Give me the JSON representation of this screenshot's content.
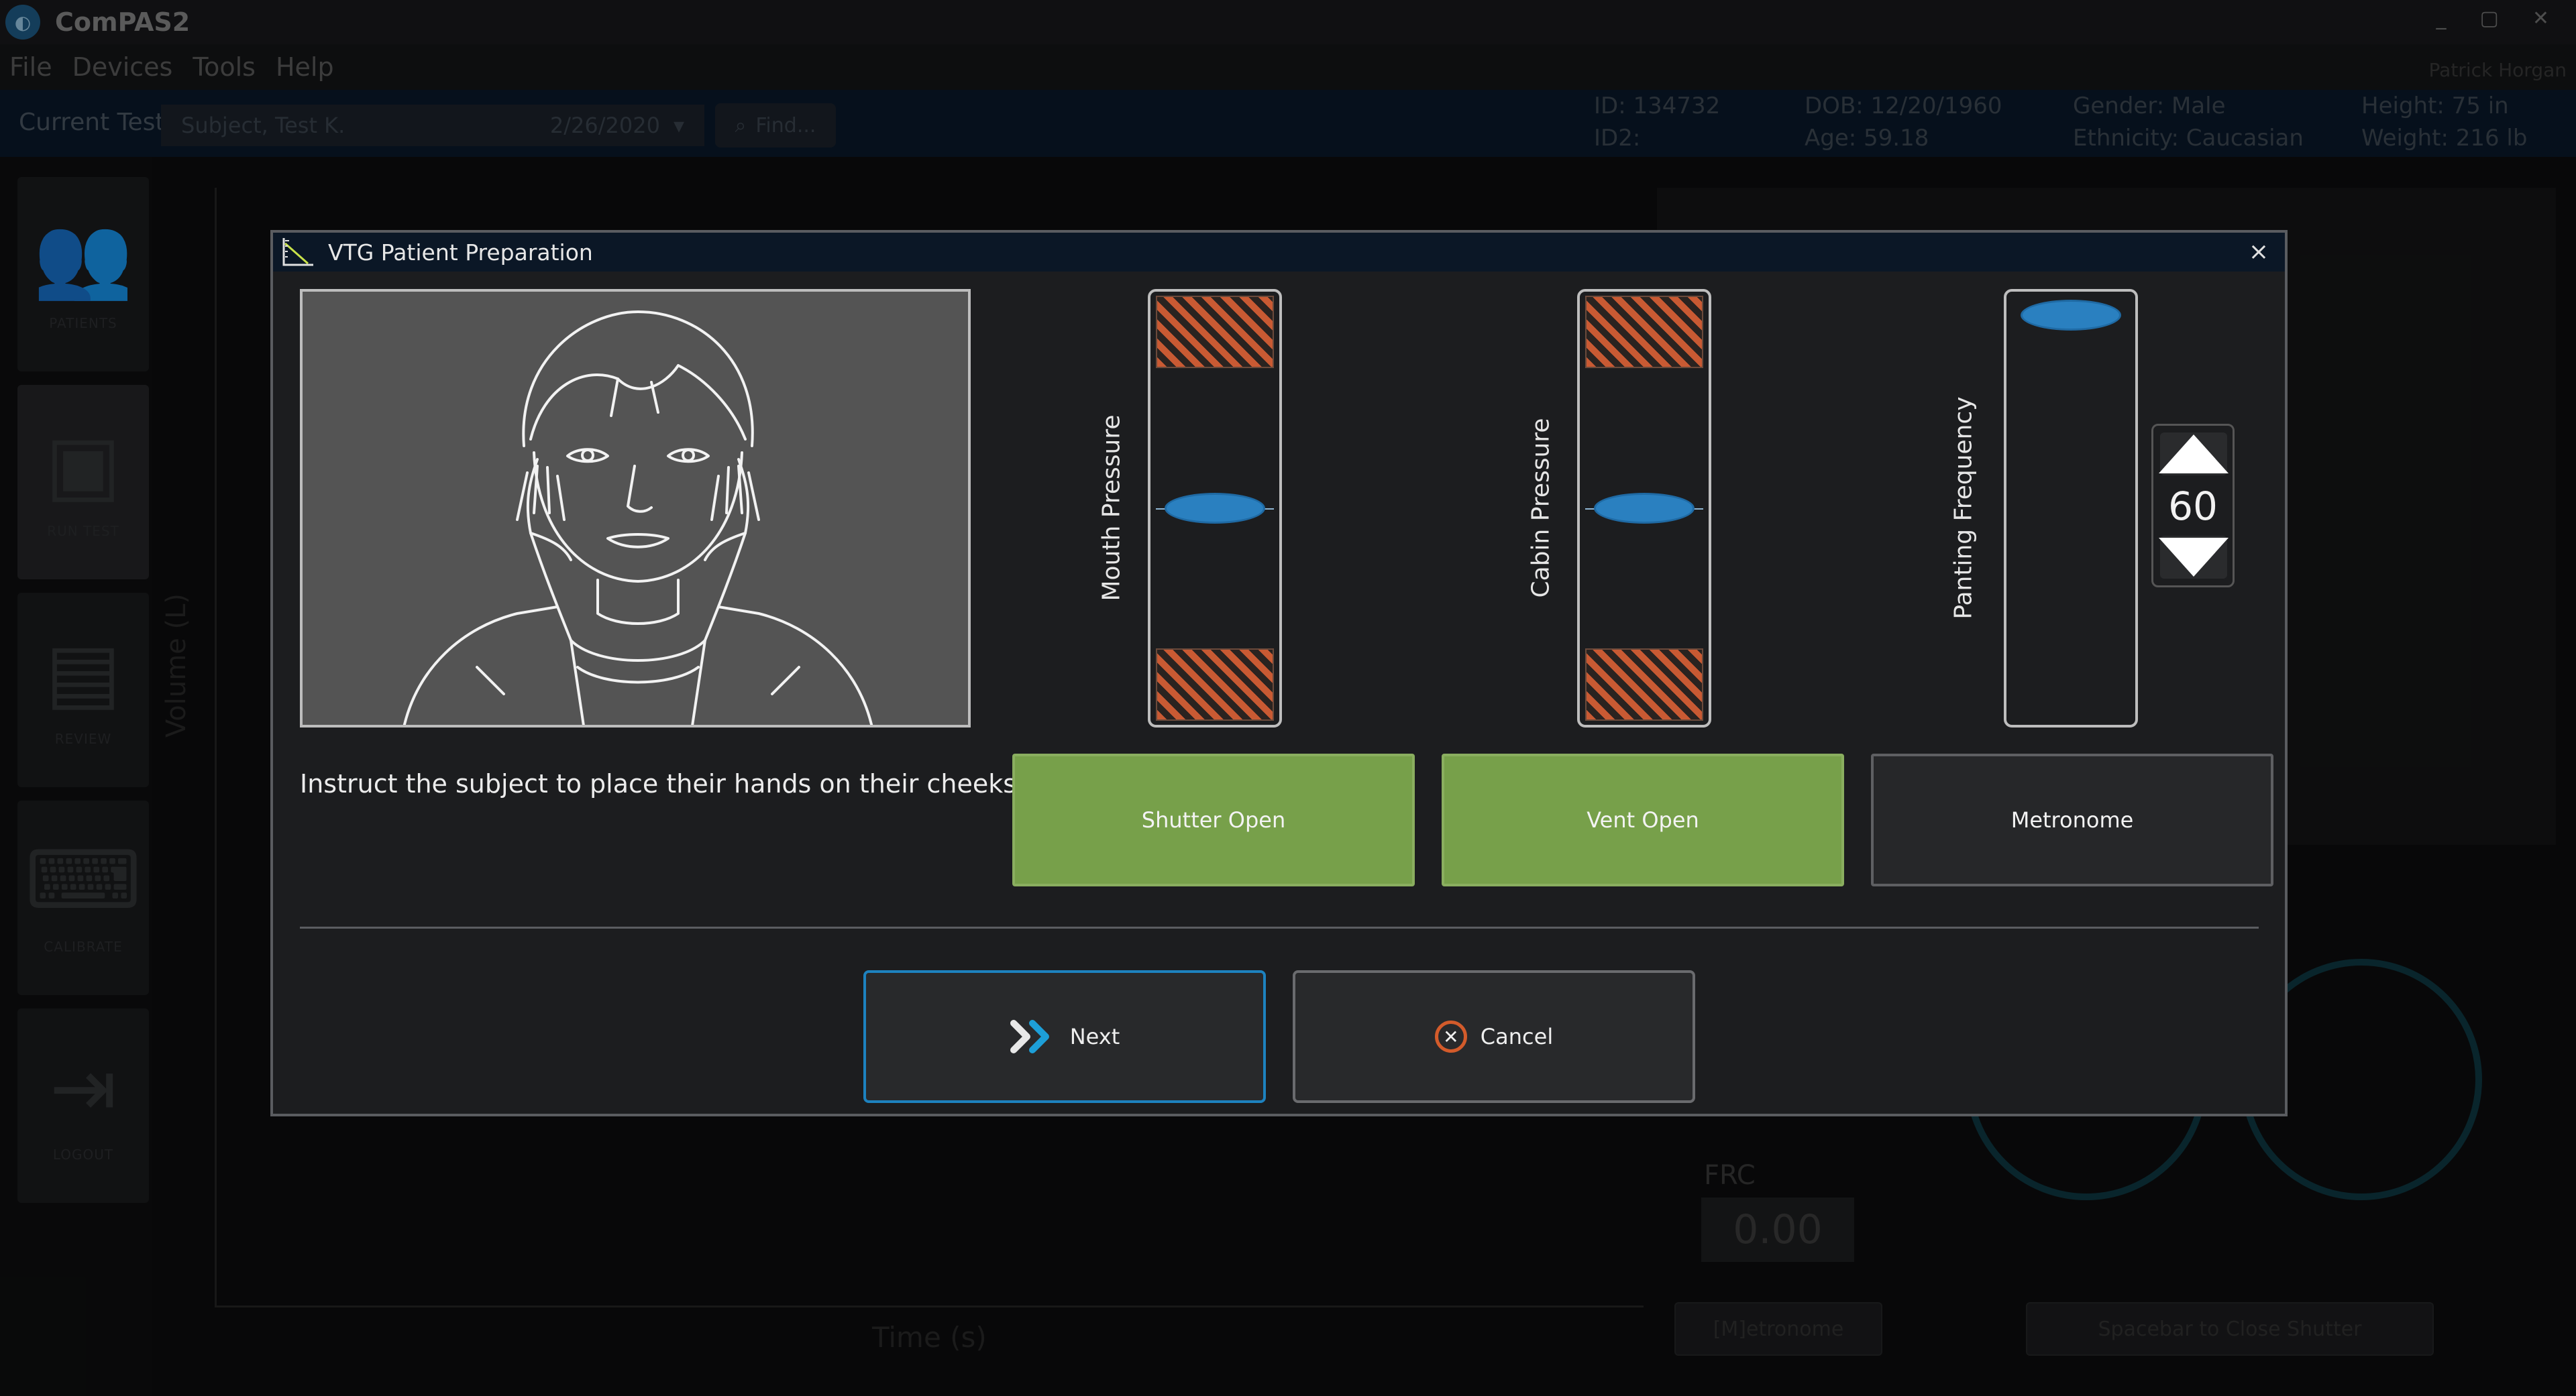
{
  "app": {
    "title": "ComPAS2",
    "window_controls": [
      "_",
      "▢",
      "✕"
    ],
    "menu": [
      "File",
      "Devices",
      "Tools",
      "Help"
    ],
    "user": "Patrick Horgan"
  },
  "test_bar": {
    "label": "Current Test:",
    "test_name": "Subject, Test K.",
    "test_date": "2/26/2020",
    "find_label": "Find..."
  },
  "patient": {
    "id": "ID: 134732",
    "id2": "ID2:",
    "dob": "DOB: 12/20/1960",
    "age": "Age: 59.18",
    "gender": "Gender: Male",
    "ethnicity": "Ethnicity: Caucasian",
    "height": "Height: 75 in",
    "weight": "Weight: 216 lb"
  },
  "sidebar": {
    "items": [
      {
        "label": "PATIENTS",
        "icon": "patients-icon"
      },
      {
        "label": "RUN TEST",
        "icon": "run-test-icon"
      },
      {
        "label": "REVIEW",
        "icon": "review-icon"
      },
      {
        "label": "CALIBRATE",
        "icon": "calibrate-icon"
      },
      {
        "label": "LOGOUT",
        "icon": "logout-icon"
      }
    ]
  },
  "background": {
    "y_axis": "Volume (L)",
    "x_axis": "Time (s)",
    "frc_label": "FRC",
    "frc_value": "0.00",
    "metronome_btn": "[M]etronome",
    "spacebar_btn": "Spacebar to Close Shutter"
  },
  "modal": {
    "title": "VTG Patient Preparation",
    "close": "×",
    "instruction": "Instruct the subject to place their hands on their cheeks.",
    "gauges": {
      "mouth": {
        "label": "Mouth Pressure",
        "level": 0.5
      },
      "cabin": {
        "label": "Cabin Pressure",
        "level": 0.5
      },
      "panting": {
        "label": "Panting Frequency",
        "level": 1.0
      }
    },
    "frequency_value": "60",
    "toggles": {
      "shutter": "Shutter Open",
      "vent": "Vent Open",
      "metronome": "Metronome"
    },
    "actions": {
      "next": "Next",
      "cancel": "Cancel",
      "cancel_glyph": "✕"
    },
    "colors": {
      "accent": "#1d82bf",
      "toggle_on": "#77a04a",
      "warning_hatch": "#c95a33",
      "indicator": "#2a80c0"
    }
  }
}
